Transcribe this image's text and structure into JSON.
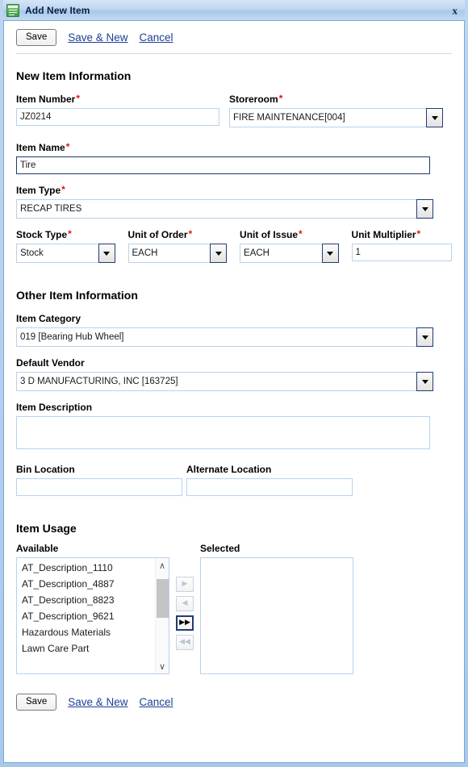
{
  "window": {
    "title": "Add New Item",
    "icon": "list-document-icon",
    "close_label": "x",
    "accent": "#1f3d70",
    "required_color": "#e21414",
    "link_color": "#1f3f96"
  },
  "toolbar": {
    "save_label": "Save",
    "save_new_label": "Save & New",
    "cancel_label": "Cancel"
  },
  "sections": {
    "new_item": "New Item Information",
    "other_item": "Other Item Information",
    "item_usage": "Item Usage"
  },
  "fields": {
    "item_number": {
      "label": "Item Number",
      "required": "*",
      "value": "JZ0214",
      "placeholder": ""
    },
    "storeroom": {
      "label": "Storeroom",
      "required": "*",
      "value": "FIRE MAINTENANCE[004]"
    },
    "item_name": {
      "label": "Item Name",
      "required": "*",
      "value": "Tire",
      "placeholder": ""
    },
    "item_type": {
      "label": "Item Type",
      "required": "*",
      "value": "RECAP TIRES"
    },
    "stock_type": {
      "label": "Stock Type",
      "required": "*",
      "value": "Stock"
    },
    "unit_of_order": {
      "label": "Unit of Order",
      "required": "*",
      "value": "EACH"
    },
    "unit_of_issue": {
      "label": "Unit of Issue",
      "required": "*",
      "value": "EACH"
    },
    "unit_multiplier": {
      "label": "Unit Multiplier",
      "required": "*",
      "value": "1",
      "placeholder": ""
    },
    "item_category": {
      "label": "Item Category",
      "value": "019 [Bearing Hub Wheel]"
    },
    "default_vendor": {
      "label": "Default Vendor",
      "value": "3 D MANUFACTURING, INC [163725]"
    },
    "item_description": {
      "label": "Item Description",
      "value": "",
      "placeholder": ""
    },
    "bin_location": {
      "label": "Bin Location",
      "value": "",
      "placeholder": ""
    },
    "alternate_location": {
      "label": "Alternate Location",
      "value": "",
      "placeholder": ""
    }
  },
  "item_usage": {
    "available_label": "Available",
    "selected_label": "Selected",
    "available_items": [
      "AT_Description_1110",
      "AT_Description_4887",
      "AT_Description_8823",
      "AT_Description_9621",
      "Hazardous Materials",
      "Lawn Care Part"
    ],
    "selected_items": [],
    "transfer_buttons": [
      {
        "name": "move-right",
        "glyph": "▶",
        "enabled": false
      },
      {
        "name": "move-left",
        "glyph": "◀",
        "enabled": false
      },
      {
        "name": "move-all-right",
        "glyph": "▶▶",
        "enabled": true
      },
      {
        "name": "move-all-left",
        "glyph": "◀◀",
        "enabled": false
      }
    ],
    "scroll_up_glyph": "∧",
    "scroll_down_glyph": "∨"
  }
}
